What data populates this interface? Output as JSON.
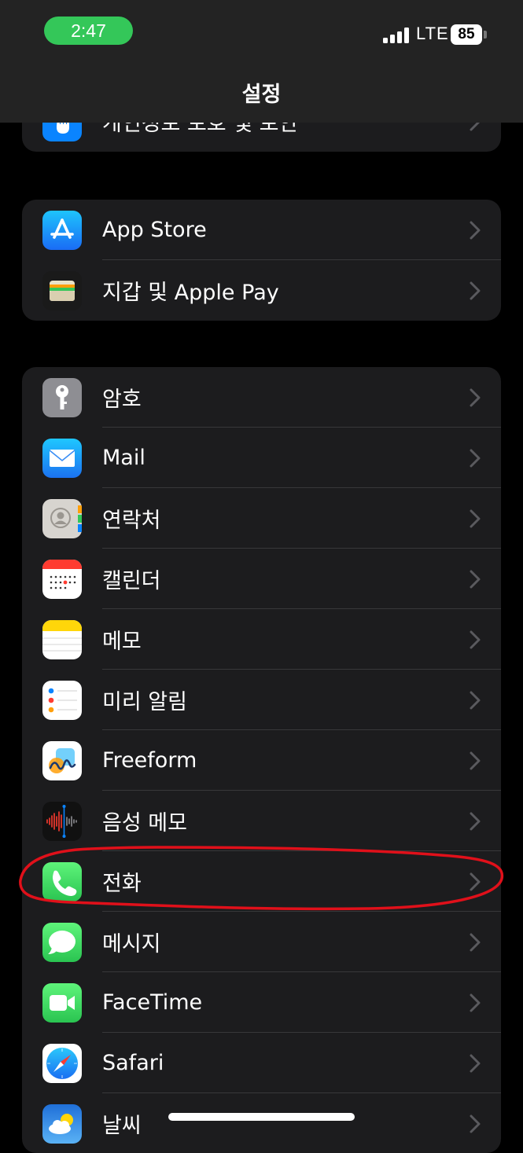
{
  "status_bar": {
    "time": "2:47",
    "network": "LTE",
    "battery": "85"
  },
  "header": {
    "title": "설정"
  },
  "groups": [
    {
      "items": [
        {
          "label": "개인정보 보호 및 보안",
          "icon": "hand-privacy-icon"
        }
      ]
    },
    {
      "items": [
        {
          "label": "App Store",
          "icon": "app-store-icon"
        },
        {
          "label": "지갑 및 Apple Pay",
          "icon": "wallet-icon"
        }
      ]
    },
    {
      "items": [
        {
          "label": "암호",
          "icon": "key-icon"
        },
        {
          "label": "Mail",
          "icon": "mail-icon"
        },
        {
          "label": "연락처",
          "icon": "contacts-icon"
        },
        {
          "label": "캘린더",
          "icon": "calendar-icon"
        },
        {
          "label": "메모",
          "icon": "notes-icon"
        },
        {
          "label": "미리 알림",
          "icon": "reminders-icon"
        },
        {
          "label": "Freeform",
          "icon": "freeform-icon"
        },
        {
          "label": "음성 메모",
          "icon": "voice-memos-icon"
        },
        {
          "label": "전화",
          "icon": "phone-icon"
        },
        {
          "label": "메시지",
          "icon": "messages-icon"
        },
        {
          "label": "FaceTime",
          "icon": "facetime-icon"
        },
        {
          "label": "Safari",
          "icon": "safari-icon"
        },
        {
          "label": "날씨",
          "icon": "weather-icon"
        }
      ]
    }
  ],
  "colors": {
    "green": "#34c759",
    "cell": "#1c1c1e",
    "annotation": "#e0101a"
  }
}
